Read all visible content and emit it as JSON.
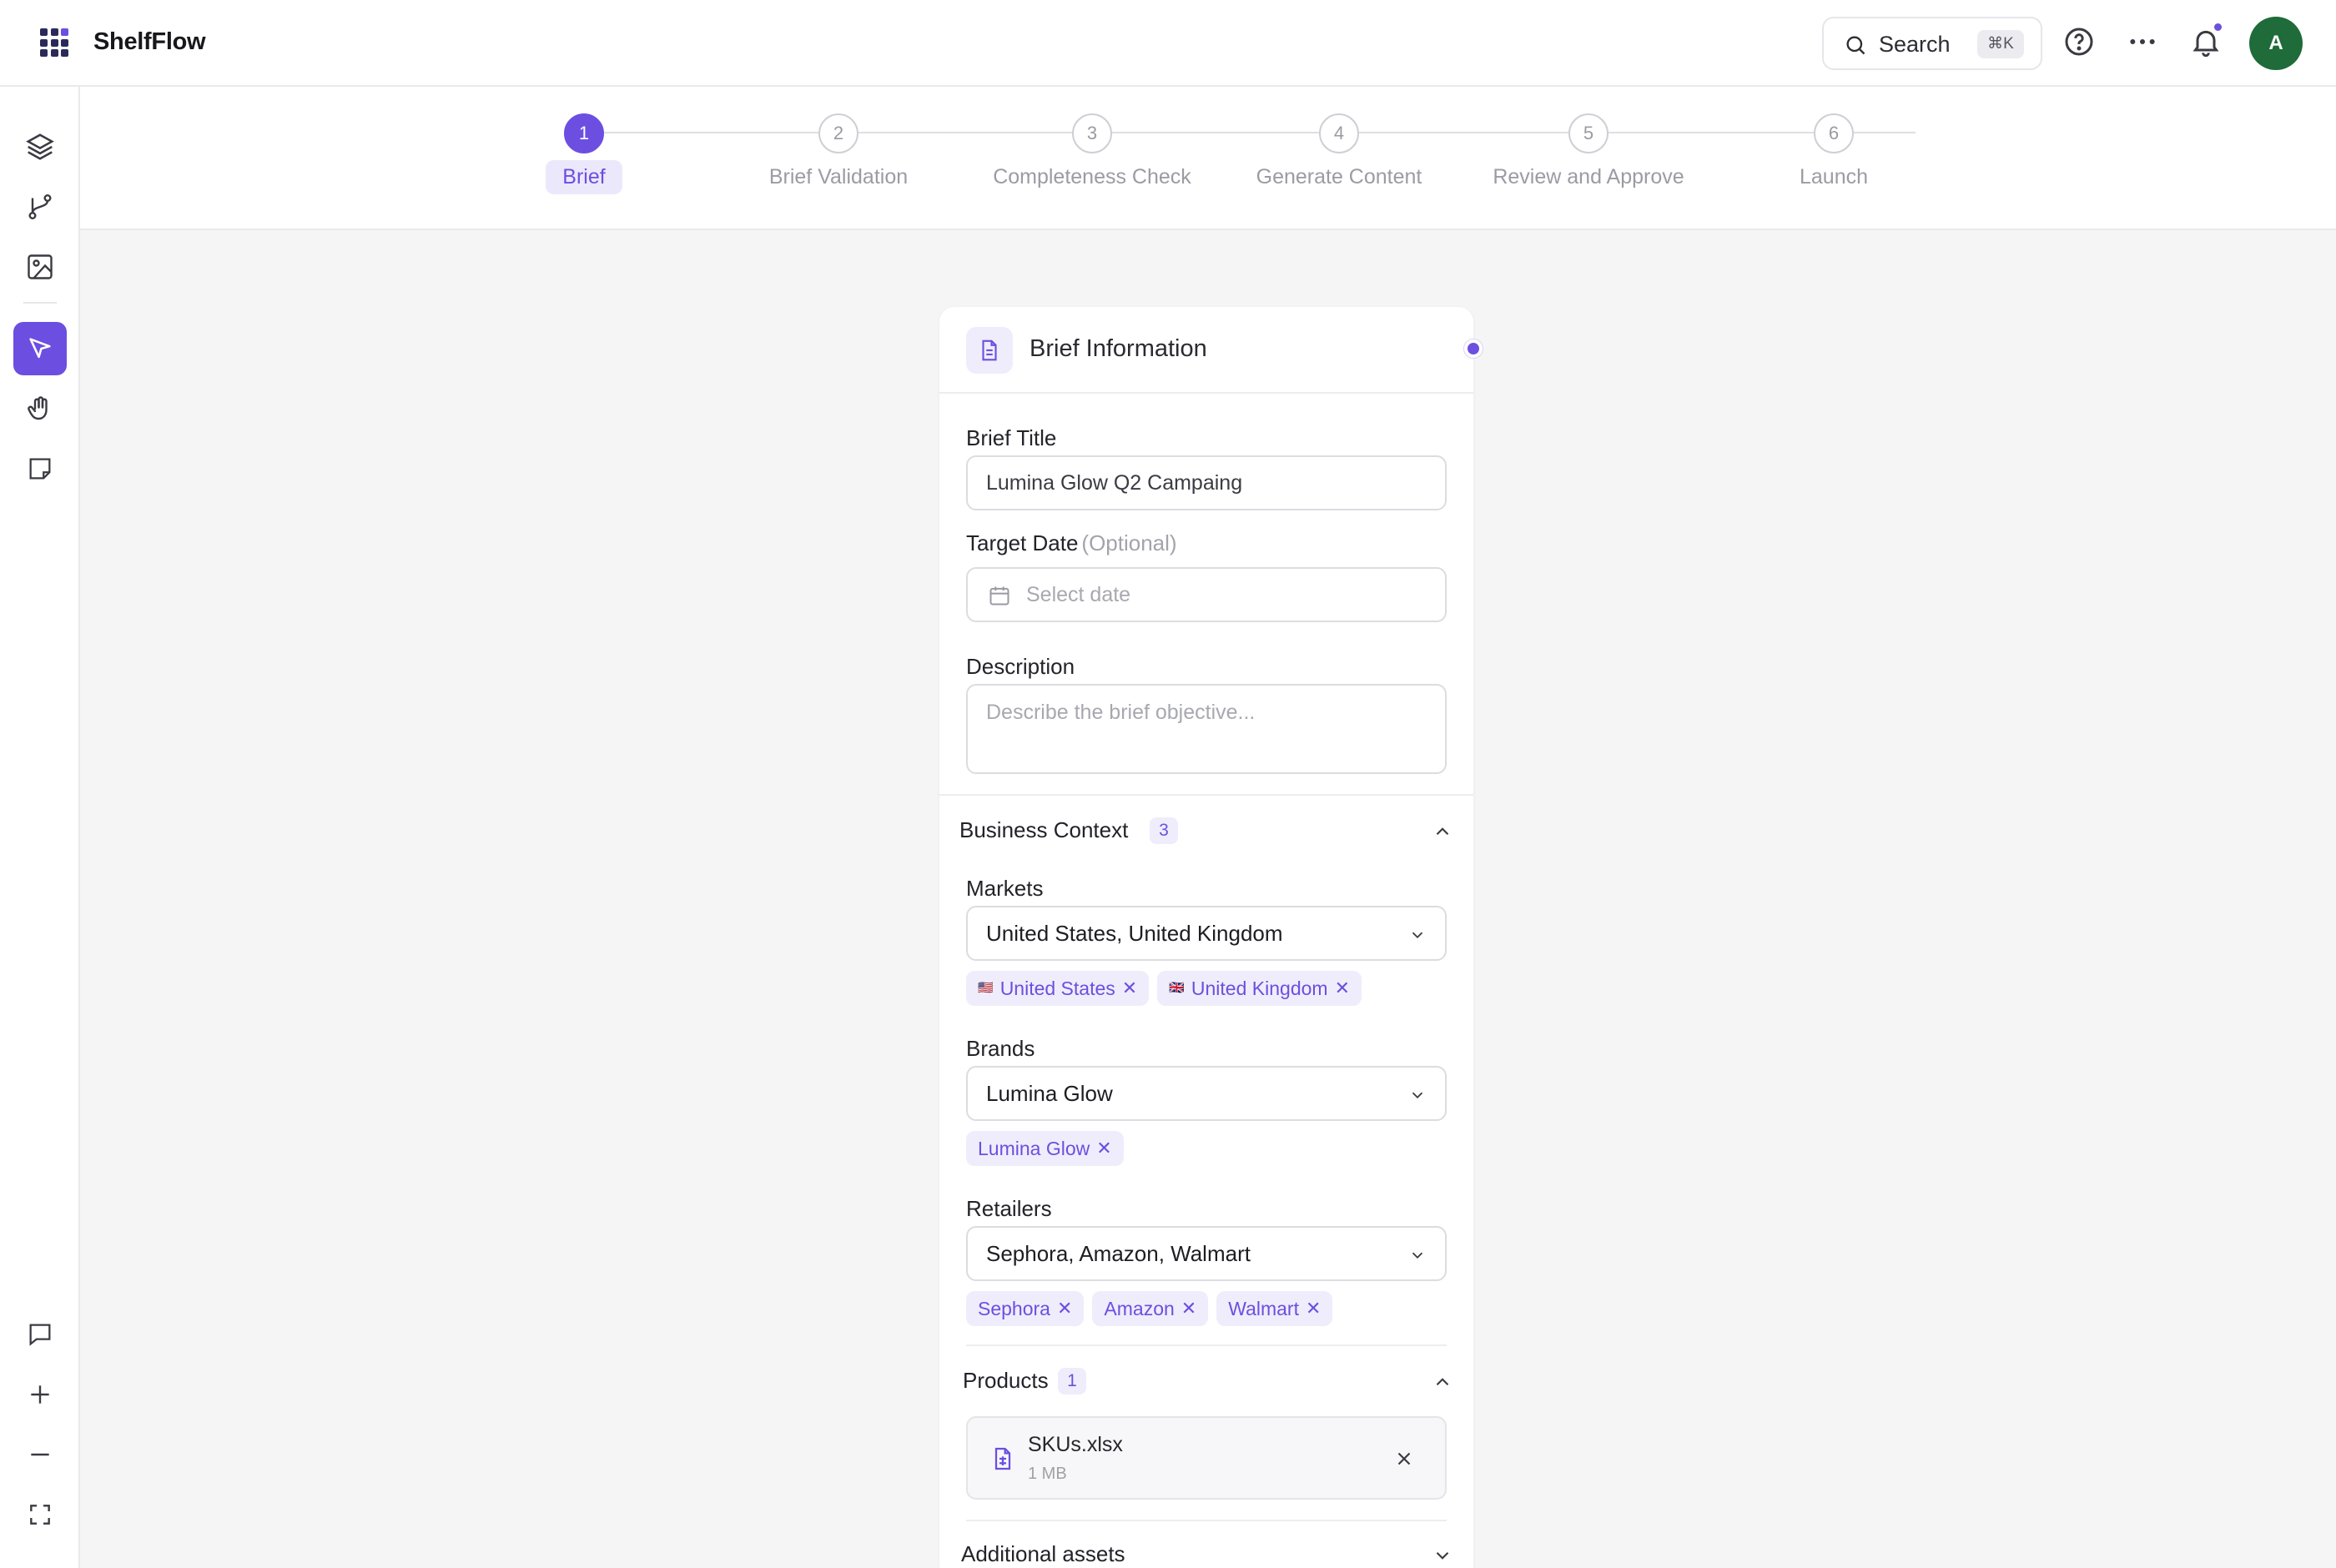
{
  "app": {
    "name": "ShelfFlow"
  },
  "topbar": {
    "search_label": "Search",
    "search_shortcut": "⌘K",
    "avatar_initial": "A"
  },
  "stepper": {
    "steps": [
      {
        "number": "1",
        "label": "Brief",
        "active": true
      },
      {
        "number": "2",
        "label": "Brief Validation",
        "active": false
      },
      {
        "number": "3",
        "label": "Completeness Check",
        "active": false
      },
      {
        "number": "4",
        "label": "Generate Content",
        "active": false
      },
      {
        "number": "5",
        "label": "Review and Approve",
        "active": false
      },
      {
        "number": "6",
        "label": "Launch",
        "active": false
      }
    ]
  },
  "brief": {
    "card_title": "Brief Information",
    "title_label": "Brief Title",
    "title_value": "Lumina Glow Q2 Campaing",
    "date_label": "Target Date",
    "date_optional": "(Optional)",
    "date_placeholder": "Select date",
    "description_label": "Description",
    "description_placeholder": "Describe the brief objective..."
  },
  "business_context": {
    "title": "Business Context",
    "count": "3",
    "markets_label": "Markets",
    "markets_value": "United States, United Kingdom",
    "markets_chips": [
      {
        "flag": "🇺🇸",
        "label": "United States"
      },
      {
        "flag": "🇬🇧",
        "label": "United Kingdom"
      }
    ],
    "brands_label": "Brands",
    "brands_value": "Lumina Glow",
    "brands_chips": [
      "Lumina Glow"
    ],
    "retailers_label": "Retailers",
    "retailers_value": "Sephora, Amazon, Walmart",
    "retailers_chips": [
      "Sephora",
      "Amazon",
      "Walmart"
    ]
  },
  "products": {
    "title": "Products",
    "count": "1",
    "file_name": "SKUs.xlsx",
    "file_size": "1 MB"
  },
  "additional_assets": {
    "title": "Additional assets"
  },
  "colors": {
    "accent": "#6c4fe0",
    "avatar_bg": "#1f6b3a"
  }
}
